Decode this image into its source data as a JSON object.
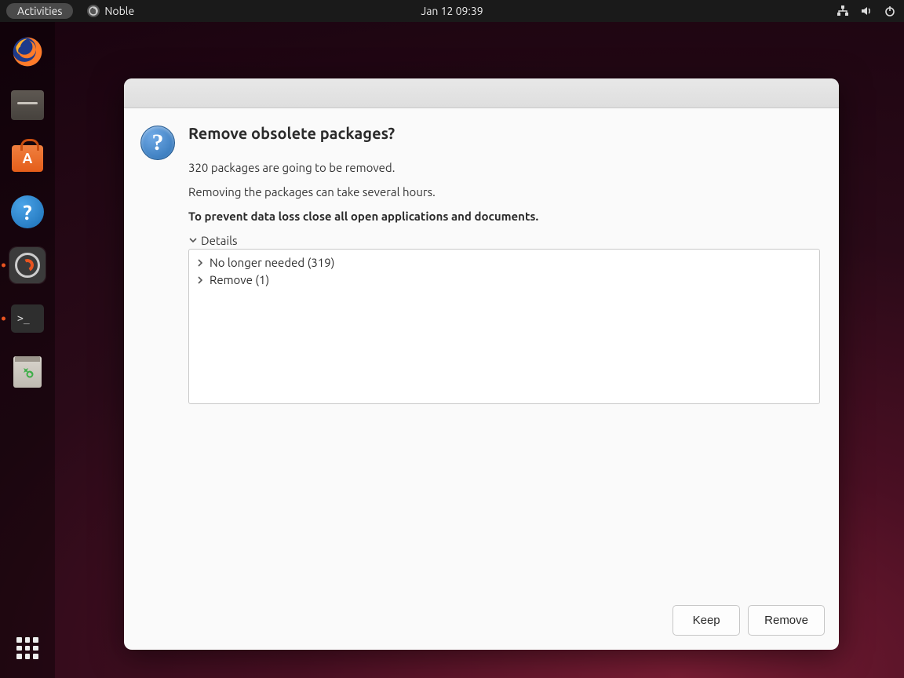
{
  "topbar": {
    "activities": "Activities",
    "app_name": "Noble",
    "clock": "Jan 12  09:39"
  },
  "dock": {
    "items": [
      {
        "name": "firefox"
      },
      {
        "name": "files"
      },
      {
        "name": "software-store"
      },
      {
        "name": "help"
      },
      {
        "name": "software-updater",
        "active": true
      },
      {
        "name": "terminal",
        "active": true
      },
      {
        "name": "trash"
      }
    ]
  },
  "dialog": {
    "heading": "Remove obsolete packages?",
    "line1": "320 packages are going to be removed.",
    "line2": "Removing the packages can take several hours.",
    "warning": "To prevent data loss close all open applications and documents.",
    "details_label": "Details",
    "tree": [
      {
        "label": "No longer needed (319)"
      },
      {
        "label": "Remove (1)"
      }
    ],
    "buttons": {
      "keep": "Keep",
      "remove": "Remove"
    }
  }
}
